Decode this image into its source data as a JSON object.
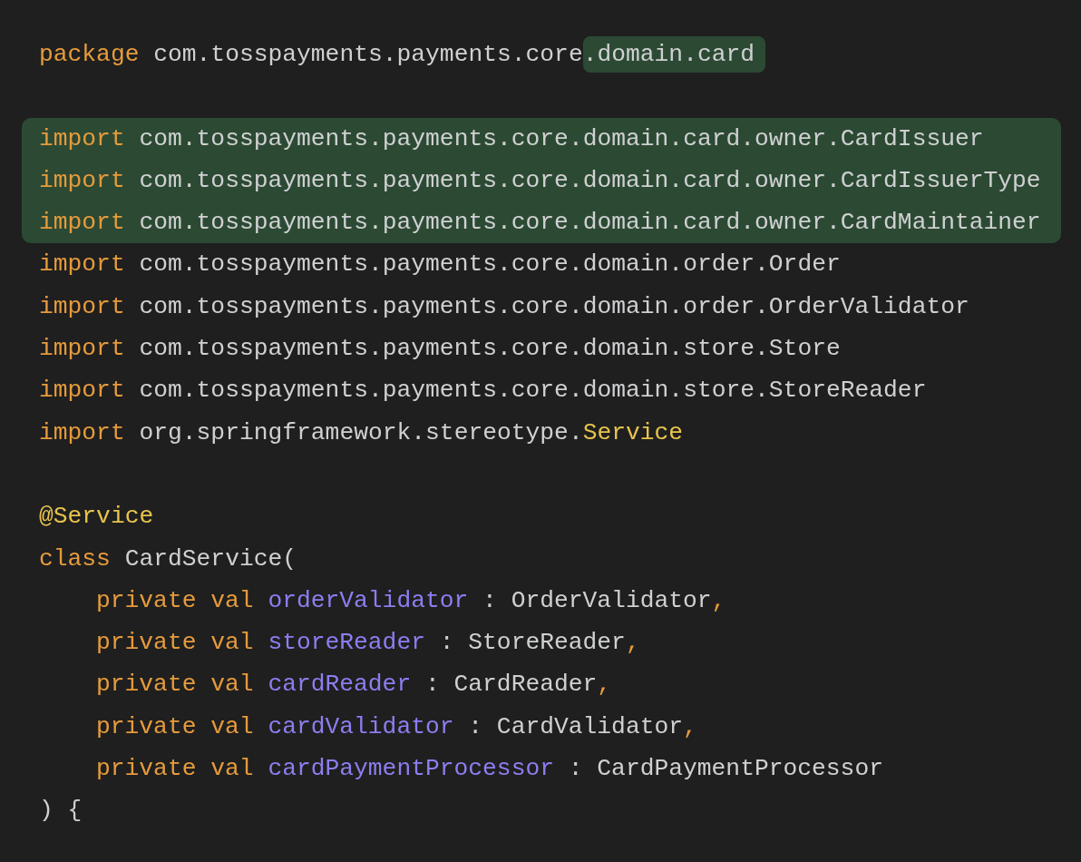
{
  "sections": [
    {
      "lines": [
        {
          "highlighted": false,
          "tokens": [
            {
              "kind": "keyword",
              "text": "package"
            },
            {
              "kind": "plain",
              "text": " com.tosspayments.payments.core"
            },
            {
              "kind": "plain",
              "text": ".domain.card",
              "highlighted": true
            }
          ]
        }
      ]
    },
    {
      "lines": [
        {
          "highlighted": true,
          "tokens": [
            {
              "kind": "keyword",
              "text": "import"
            },
            {
              "kind": "plain",
              "text": " com.tosspayments.payments.core.domain.card.owner.CardIssuer"
            }
          ]
        },
        {
          "highlighted": true,
          "tokens": [
            {
              "kind": "keyword",
              "text": "import"
            },
            {
              "kind": "plain",
              "text": " com.tosspayments.payments.core.domain.card.owner.CardIssuerType"
            }
          ]
        },
        {
          "highlighted": true,
          "tokens": [
            {
              "kind": "keyword",
              "text": "import"
            },
            {
              "kind": "plain",
              "text": " com.tosspayments.payments.core.domain.card.owner.CardMaintainer"
            }
          ]
        },
        {
          "highlighted": false,
          "tokens": [
            {
              "kind": "keyword",
              "text": "import"
            },
            {
              "kind": "plain",
              "text": " com.tosspayments.payments.core.domain.order.Order"
            }
          ]
        },
        {
          "highlighted": false,
          "tokens": [
            {
              "kind": "keyword",
              "text": "import"
            },
            {
              "kind": "plain",
              "text": " com.tosspayments.payments.core.domain.order.OrderValidator"
            }
          ]
        },
        {
          "highlighted": false,
          "tokens": [
            {
              "kind": "keyword",
              "text": "import"
            },
            {
              "kind": "plain",
              "text": " com.tosspayments.payments.core.domain.store.Store"
            }
          ]
        },
        {
          "highlighted": false,
          "tokens": [
            {
              "kind": "keyword",
              "text": "import"
            },
            {
              "kind": "plain",
              "text": " com.tosspayments.payments.core.domain.store.StoreReader"
            }
          ]
        },
        {
          "highlighted": false,
          "tokens": [
            {
              "kind": "keyword",
              "text": "import"
            },
            {
              "kind": "plain",
              "text": " org.springframework.stereotype."
            },
            {
              "kind": "annotation",
              "text": "Service"
            }
          ]
        }
      ]
    },
    {
      "lines": [
        {
          "highlighted": false,
          "tokens": [
            {
              "kind": "annotation",
              "text": "@Service"
            }
          ]
        },
        {
          "highlighted": false,
          "tokens": [
            {
              "kind": "keyword",
              "text": "class"
            },
            {
              "kind": "plain",
              "text": " CardService("
            }
          ]
        },
        {
          "highlighted": false,
          "indented": true,
          "tokens": [
            {
              "kind": "keyword",
              "text": "private val "
            },
            {
              "kind": "property",
              "text": "orderValidator"
            },
            {
              "kind": "plain",
              "text": " : OrderValidator"
            },
            {
              "kind": "keyword",
              "text": ","
            }
          ]
        },
        {
          "highlighted": false,
          "indented": true,
          "tokens": [
            {
              "kind": "keyword",
              "text": "private val "
            },
            {
              "kind": "property",
              "text": "storeReader"
            },
            {
              "kind": "plain",
              "text": " : StoreReader"
            },
            {
              "kind": "keyword",
              "text": ","
            }
          ]
        },
        {
          "highlighted": false,
          "indented": true,
          "tokens": [
            {
              "kind": "keyword",
              "text": "private val "
            },
            {
              "kind": "property",
              "text": "cardReader"
            },
            {
              "kind": "plain",
              "text": " : CardReader"
            },
            {
              "kind": "keyword",
              "text": ","
            }
          ]
        },
        {
          "highlighted": false,
          "indented": true,
          "tokens": [
            {
              "kind": "keyword",
              "text": "private val "
            },
            {
              "kind": "property",
              "text": "cardValidator"
            },
            {
              "kind": "plain",
              "text": " : CardValidator"
            },
            {
              "kind": "keyword",
              "text": ","
            }
          ]
        },
        {
          "highlighted": false,
          "indented": true,
          "tokens": [
            {
              "kind": "keyword",
              "text": "private val "
            },
            {
              "kind": "property",
              "text": "cardPaymentProcessor"
            },
            {
              "kind": "plain",
              "text": " : CardPaymentProcessor"
            }
          ]
        },
        {
          "highlighted": false,
          "tokens": [
            {
              "kind": "plain",
              "text": ") {"
            }
          ]
        }
      ]
    }
  ]
}
